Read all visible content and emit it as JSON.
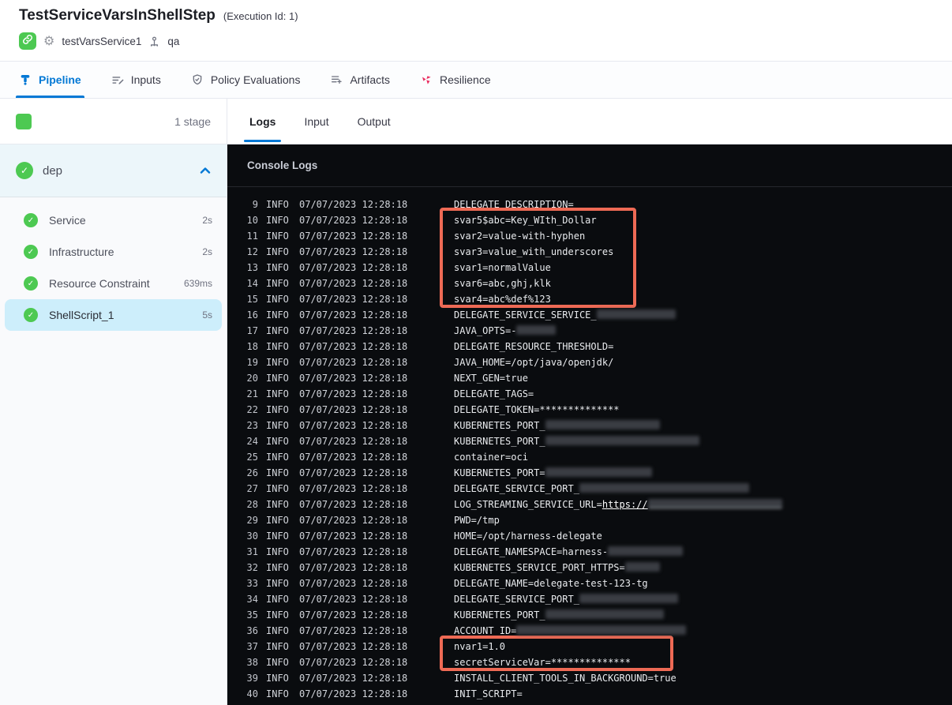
{
  "header": {
    "title": "TestServiceVarsInShellStep",
    "execution_id_label": "(Execution Id: 1)",
    "service_status_icon": "link-icon",
    "service_icon": "gear-icon",
    "service_name": "testVarsService1",
    "environment_icon": "delegate-icon",
    "environment_name": "qa"
  },
  "main_tabs": [
    {
      "label": "Pipeline",
      "icon": "pipeline-icon",
      "active": true
    },
    {
      "label": "Inputs",
      "icon": "inputs-icon",
      "active": false
    },
    {
      "label": "Policy Evaluations",
      "icon": "shield-check-icon",
      "active": false
    },
    {
      "label": "Artifacts",
      "icon": "artifacts-icon",
      "active": false
    },
    {
      "label": "Resilience",
      "icon": "resilience-icon",
      "active": false
    }
  ],
  "sidebar": {
    "stage_count_label": "1 stage",
    "stage": {
      "name": "dep",
      "status": "success",
      "expanded": true
    },
    "steps": [
      {
        "name": "Service",
        "duration": "2s",
        "status": "success",
        "selected": false
      },
      {
        "name": "Infrastructure",
        "duration": "2s",
        "status": "success",
        "selected": false
      },
      {
        "name": "Resource Constraint",
        "duration": "639ms",
        "status": "success",
        "selected": false
      },
      {
        "name": "ShellScript_1",
        "duration": "5s",
        "status": "success",
        "selected": true
      }
    ]
  },
  "logs_panel": {
    "tabs": [
      {
        "label": "Logs",
        "active": true
      },
      {
        "label": "Input",
        "active": false
      },
      {
        "label": "Output",
        "active": false
      }
    ],
    "console_title": "Console Logs",
    "log_level": "INFO",
    "timestamp": "07/07/2023 12:28:18",
    "lines": [
      {
        "num": 9,
        "msg": [
          {
            "t": "DELEGATE_DESCRIPTION="
          }
        ]
      },
      {
        "num": 10,
        "msg": [
          {
            "t": "svar5$abc=Key_WIth_Dollar"
          }
        ]
      },
      {
        "num": 11,
        "msg": [
          {
            "t": "svar2=value-with-hyphen"
          }
        ]
      },
      {
        "num": 12,
        "msg": [
          {
            "t": "svar3=value_with_underscores"
          }
        ]
      },
      {
        "num": 13,
        "msg": [
          {
            "t": "svar1=normalValue"
          }
        ]
      },
      {
        "num": 14,
        "msg": [
          {
            "t": "svar6=abc,ghj,klk"
          }
        ]
      },
      {
        "num": 15,
        "msg": [
          {
            "t": "svar4=abc%def%123"
          }
        ]
      },
      {
        "num": 16,
        "msg": [
          {
            "t": "DELEGATE_SERVICE_SERVICE_"
          },
          {
            "r": 100
          }
        ]
      },
      {
        "num": 17,
        "msg": [
          {
            "t": "JAVA_OPTS=-"
          },
          {
            "r": 50
          }
        ]
      },
      {
        "num": 18,
        "msg": [
          {
            "t": "DELEGATE_RESOURCE_THRESHOLD="
          }
        ]
      },
      {
        "num": 19,
        "msg": [
          {
            "t": "JAVA_HOME=/opt/java/openjdk/"
          }
        ]
      },
      {
        "num": 20,
        "msg": [
          {
            "t": "NEXT_GEN=true"
          }
        ]
      },
      {
        "num": 21,
        "msg": [
          {
            "t": "DELEGATE_TAGS="
          }
        ]
      },
      {
        "num": 22,
        "msg": [
          {
            "t": "DELEGATE_TOKEN=**************"
          }
        ]
      },
      {
        "num": 23,
        "msg": [
          {
            "t": "KUBERNETES_PORT_"
          },
          {
            "r": 145
          }
        ]
      },
      {
        "num": 24,
        "msg": [
          {
            "t": "KUBERNETES_PORT_"
          },
          {
            "r": 195
          }
        ]
      },
      {
        "num": 25,
        "msg": [
          {
            "t": "container=oci"
          }
        ]
      },
      {
        "num": 26,
        "msg": [
          {
            "t": "KUBERNETES_PORT="
          },
          {
            "r": 135
          }
        ]
      },
      {
        "num": 27,
        "msg": [
          {
            "t": "DELEGATE_SERVICE_PORT_"
          },
          {
            "r": 215
          }
        ]
      },
      {
        "num": 28,
        "msg": [
          {
            "t": "LOG_STREAMING_SERVICE_URL="
          },
          {
            "t": "https://",
            "u": true
          },
          {
            "r": 170,
            "u": true
          }
        ]
      },
      {
        "num": 29,
        "msg": [
          {
            "t": "PWD=/tmp"
          }
        ]
      },
      {
        "num": 30,
        "msg": [
          {
            "t": "HOME=/opt/harness-delegate"
          }
        ]
      },
      {
        "num": 31,
        "msg": [
          {
            "t": "DELEGATE_NAMESPACE=harness-"
          },
          {
            "r": 95
          }
        ]
      },
      {
        "num": 32,
        "msg": [
          {
            "t": "KUBERNETES_SERVICE_PORT_HTTPS="
          },
          {
            "r": 44
          }
        ]
      },
      {
        "num": 33,
        "msg": [
          {
            "t": "DELEGATE_NAME=delegate-test-123-tg"
          }
        ]
      },
      {
        "num": 34,
        "msg": [
          {
            "t": "DELEGATE_SERVICE_PORT_"
          },
          {
            "r": 125
          }
        ]
      },
      {
        "num": 35,
        "msg": [
          {
            "t": "KUBERNETES_PORT_"
          },
          {
            "r": 150
          }
        ]
      },
      {
        "num": 36,
        "msg": [
          {
            "t": "ACCOUNT_ID="
          },
          {
            "r": 215
          }
        ]
      },
      {
        "num": 37,
        "msg": [
          {
            "t": "nvar1=1.0"
          }
        ]
      },
      {
        "num": 38,
        "msg": [
          {
            "t": "secretServiceVar=**************"
          }
        ]
      },
      {
        "num": 39,
        "msg": [
          {
            "t": "INSTALL_CLIENT_TOOLS_IN_BACKGROUND=true"
          }
        ]
      },
      {
        "num": 40,
        "msg": [
          {
            "t": "INIT_SCRIPT="
          }
        ]
      }
    ],
    "highlights": [
      {
        "name": "service-vars-highlight",
        "lines": "10-15"
      },
      {
        "name": "numeric-and-secret-var-highlight",
        "lines": "37-38"
      }
    ]
  },
  "colors": {
    "accent": "#0278d5",
    "success_green": "#4dc952",
    "highlight_red": "#ee6a55",
    "console_bg": "#0a0c0f"
  }
}
